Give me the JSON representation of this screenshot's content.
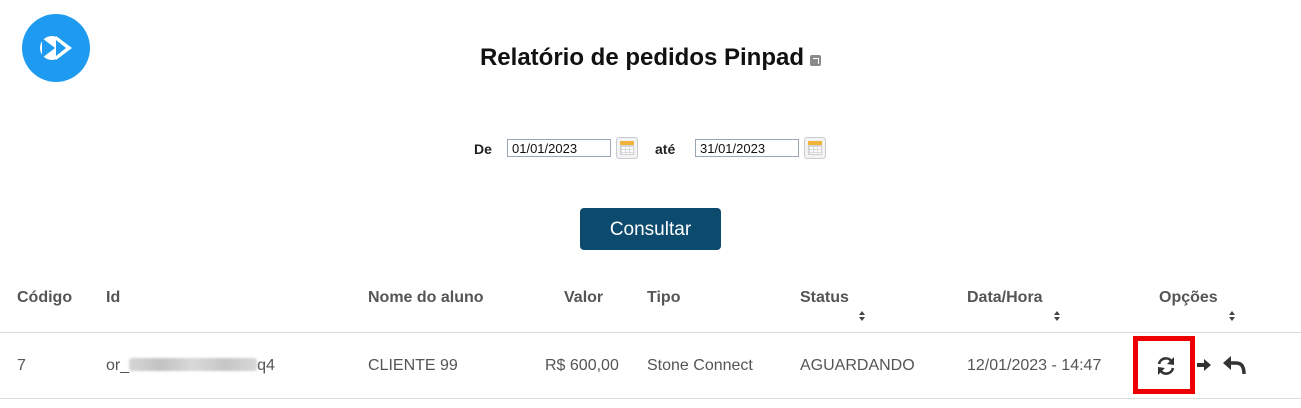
{
  "header": {
    "title": "Relatório de pedidos Pinpad",
    "logo_icon": "fast-forward-logo-icon",
    "external_icon": "external-link-icon"
  },
  "filters": {
    "from_label": "De",
    "from_value": "01/01/2023",
    "to_label": "até",
    "to_value": "31/01/2023",
    "calendar_icon": "calendar-icon"
  },
  "actions": {
    "consultar_label": "Consultar"
  },
  "table": {
    "columns": [
      "Código",
      "Id",
      "Nome do aluno",
      "Valor",
      "Tipo",
      "Status",
      "Data/Hora",
      "Opções"
    ],
    "rows": [
      {
        "codigo": "7",
        "id_prefix": "or_",
        "id_suffix": "q4",
        "nome": "CLIENTE 99",
        "valor": "R$ 600,00",
        "tipo": "Stone Connect",
        "status": "AGUARDANDO",
        "data_hora": "12/01/2023 - 14:47",
        "options_icons": [
          "refresh-icon",
          "arrow-right-icon",
          "reply-icon"
        ]
      }
    ]
  },
  "colors": {
    "logo": "#1e9bf0",
    "button": "#0c4a6e",
    "highlight": "#ee0000"
  }
}
